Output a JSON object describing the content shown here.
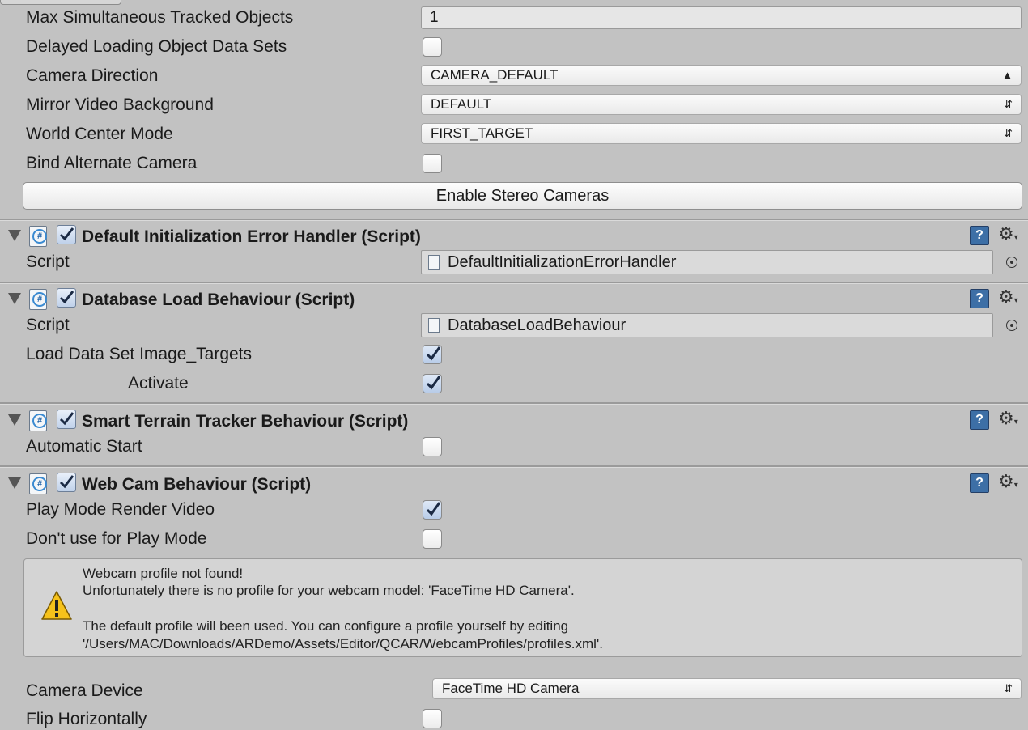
{
  "vuforia": {
    "max_tracked_label": "Max Simultaneous Tracked Objects",
    "max_tracked_value": "1",
    "delayed_loading_label": "Delayed Loading Object Data Sets",
    "camera_direction_label": "Camera Direction",
    "camera_direction_value": "CAMERA_DEFAULT",
    "mirror_label": "Mirror Video Background",
    "mirror_value": "DEFAULT",
    "world_center_label": "World Center Mode",
    "world_center_value": "FIRST_TARGET",
    "bind_alt_label": "Bind Alternate Camera",
    "stereo_button": "Enable Stereo Cameras"
  },
  "components": {
    "error_handler": {
      "title": "Default Initialization Error Handler (Script)",
      "script_label": "Script",
      "script_value": "DefaultInitializationErrorHandler"
    },
    "database_load": {
      "title": "Database Load Behaviour (Script)",
      "script_label": "Script",
      "script_value": "DatabaseLoadBehaviour",
      "load_label": "Load Data Set Image_Targets",
      "activate_label": "Activate"
    },
    "smart_terrain": {
      "title": "Smart Terrain Tracker Behaviour (Script)",
      "auto_start_label": "Automatic Start"
    },
    "webcam": {
      "title": "Web Cam Behaviour (Script)",
      "play_render_label": "Play Mode Render Video",
      "dont_use_label": "Don't use for Play Mode",
      "help_line1": "Webcam profile not found!",
      "help_line2": "Unfortunately there is no profile for your webcam model: 'FaceTime HD Camera'.",
      "help_line3": "The default profile will been used. You can configure a profile yourself by editing",
      "help_line4": "'/Users/MAC/Downloads/ARDemo/Assets/Editor/QCAR/WebcamProfiles/profiles.xml'.",
      "camera_device_label": "Camera Device",
      "camera_device_value": "FaceTime HD Camera",
      "flip_label": "Flip Horizontally"
    }
  },
  "icons": {
    "script": "csharp-script-icon",
    "help": "help-book-icon",
    "gear": "gear-icon",
    "warning": "warning-icon",
    "picker": "object-picker-icon",
    "dropdown": "dropdown-arrows-icon"
  },
  "colors": {
    "panel_bg": "#c2c2c2",
    "checkbox_checked": "#bfd1ea",
    "help_blue": "#3d6fa6"
  }
}
